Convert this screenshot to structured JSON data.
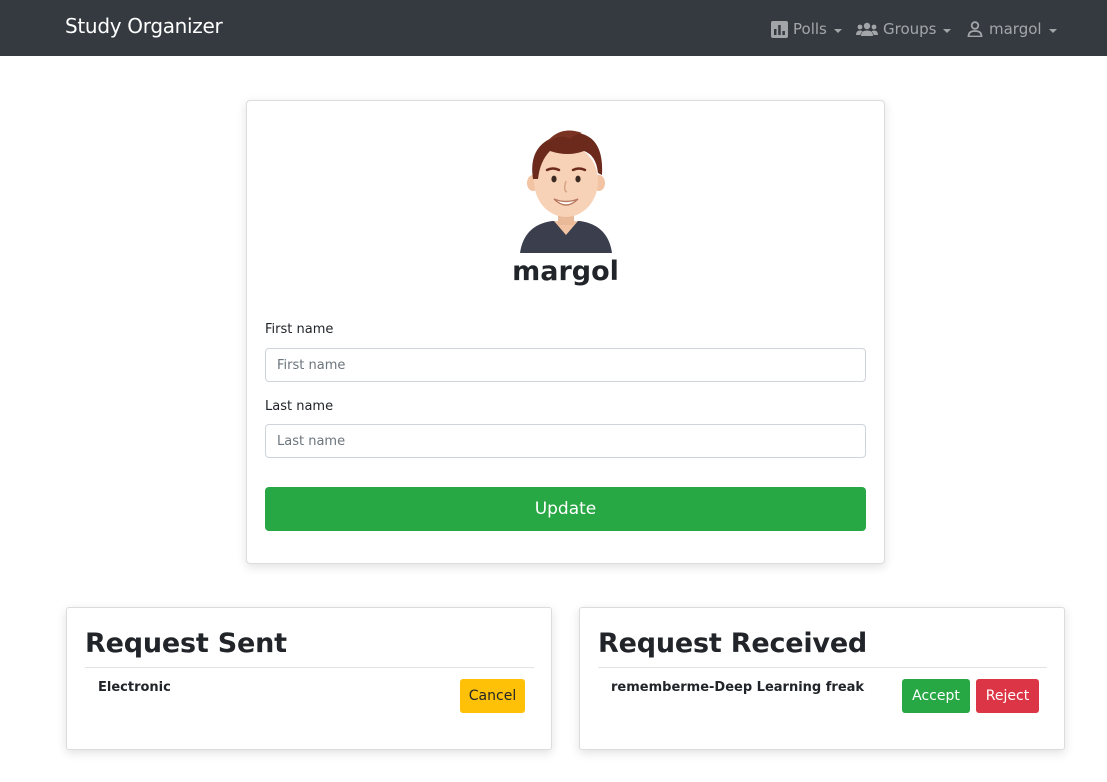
{
  "navbar": {
    "brand": "Study Organizer",
    "polls": {
      "label": "Polls",
      "icon": "bar-chart-icon"
    },
    "groups": {
      "label": "Groups",
      "icon": "users-icon"
    },
    "user": {
      "label": "margol",
      "icon": "user-icon"
    }
  },
  "profile": {
    "avatar": "avatar-icon",
    "username": "margol",
    "first_name": {
      "label": "First name",
      "placeholder": "First name",
      "value": ""
    },
    "last_name": {
      "label": "Last name",
      "placeholder": "Last name",
      "value": ""
    },
    "update_label": "Update"
  },
  "request_sent": {
    "title": "Request Sent",
    "items": [
      {
        "name": "Electronic",
        "cancel_label": "Cancel"
      }
    ]
  },
  "request_received": {
    "title": "Request Received",
    "items": [
      {
        "name": "rememberme-Deep Learning freak",
        "accept_label": "Accept",
        "reject_label": "Reject"
      }
    ]
  },
  "colors": {
    "navbar_bg": "#343a40",
    "success": "#28a745",
    "warning": "#ffc107",
    "danger": "#dc3545"
  }
}
